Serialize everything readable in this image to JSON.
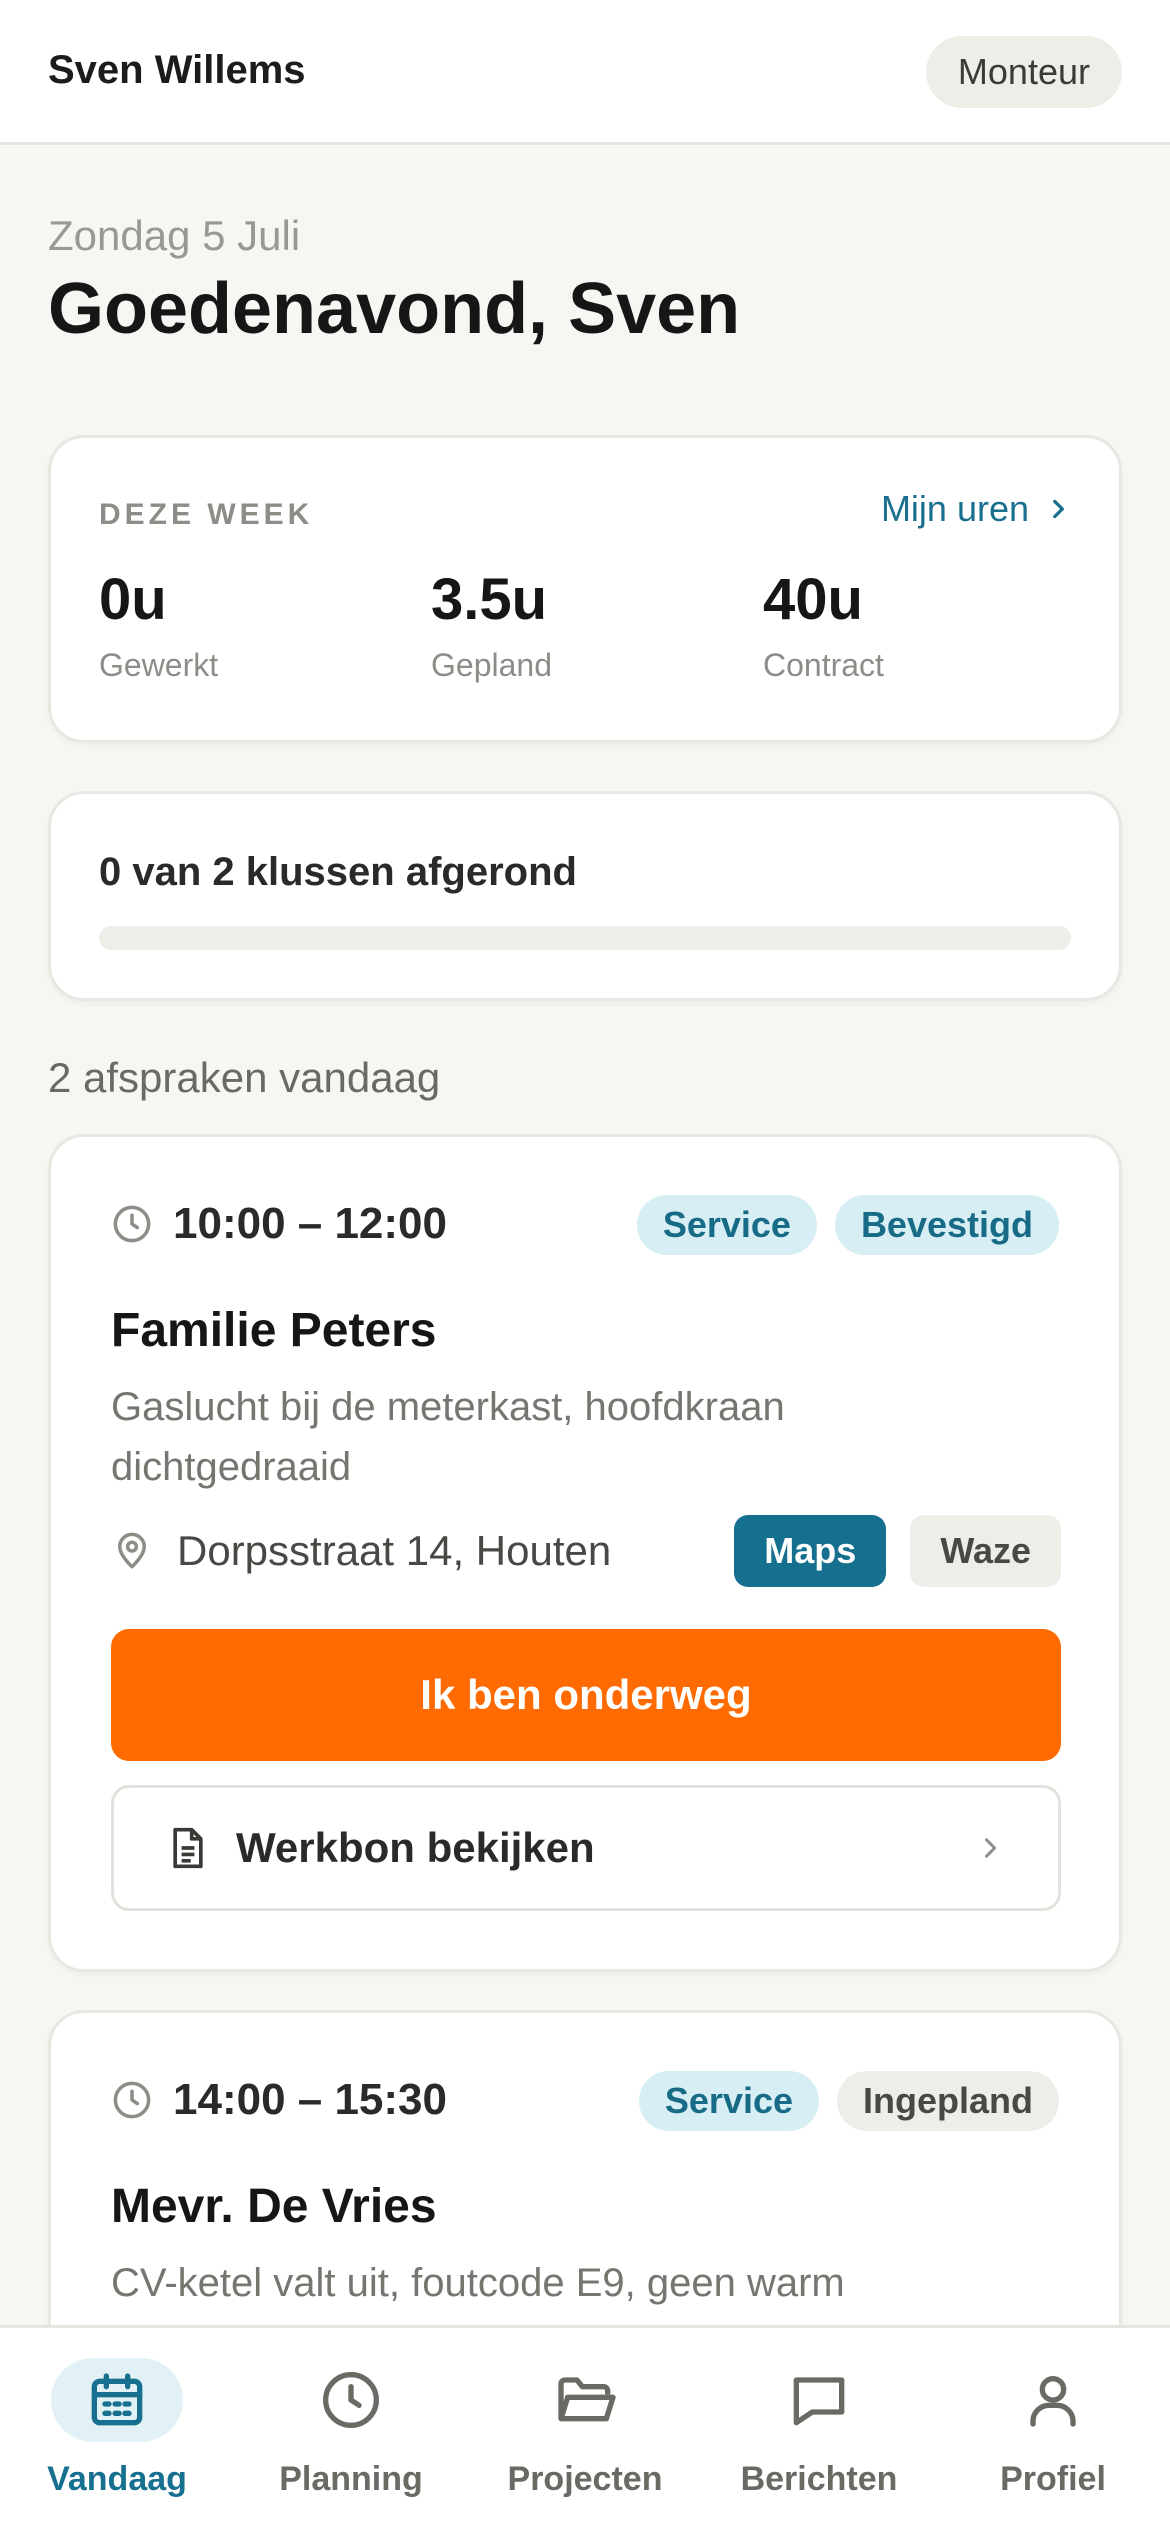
{
  "header": {
    "user_name": "Sven Willems",
    "role": "Monteur"
  },
  "greeting": {
    "date": "Zondag 5 Juli",
    "title": "Goedenavond, Sven"
  },
  "week": {
    "label": "DEZE WEEK",
    "link": "Mijn uren",
    "stats": [
      {
        "value": "0u",
        "label": "Gewerkt"
      },
      {
        "value": "3.5u",
        "label": "Gepland"
      },
      {
        "value": "40u",
        "label": "Contract"
      }
    ]
  },
  "progress": {
    "text": "0 van 2 klussen afgerond",
    "completed": 0,
    "total": 2
  },
  "appointments_heading": "2 afspraken vandaag",
  "appointments": [
    {
      "time": "10:00 – 12:00",
      "badges": [
        "Service",
        "Bevestigd"
      ],
      "client": "Familie Peters",
      "description": "Gaslucht bij de meterkast, hoofdkraan dichtgedraaid",
      "address": "Dorpsstraat 14, Houten",
      "maps_label": "Maps",
      "waze_label": "Waze",
      "primary_action": "Ik ben onderweg",
      "secondary_action": "Werkbon bekijken"
    },
    {
      "time": "14:00 – 15:30",
      "badges": [
        "Service",
        "Ingepland"
      ],
      "client": "Mevr. De Vries",
      "description": "CV-ketel valt uit, foutcode E9, geen warm"
    }
  ],
  "bottom_nav": [
    {
      "label": "Vandaag",
      "icon": "calendar-icon",
      "active": true
    },
    {
      "label": "Planning",
      "icon": "clock-icon",
      "active": false
    },
    {
      "label": "Projecten",
      "icon": "folder-icon",
      "active": false
    },
    {
      "label": "Berichten",
      "icon": "message-icon",
      "active": false
    },
    {
      "label": "Profiel",
      "icon": "user-icon",
      "active": false
    }
  ],
  "colors": {
    "accent": "#ff6b00",
    "teal": "#156f8f",
    "background": "#f7f6f2"
  }
}
